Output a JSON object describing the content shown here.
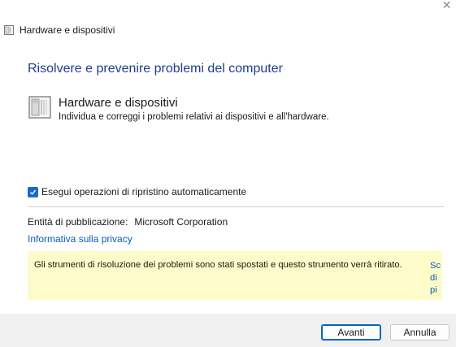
{
  "window": {
    "title": "Hardware e dispositivi",
    "close_glyph": "✕"
  },
  "heading": "Risolvere e prevenire problemi del computer",
  "item": {
    "title": "Hardware e dispositivi",
    "description": "Individua e correggi i problemi relativi ai dispositivi e all'hardware.",
    "icon": "device-icon"
  },
  "options": {
    "auto_repair_label": "Esegui operazioni di ripristino automaticamente",
    "auto_repair_checked": true
  },
  "publisher": {
    "label": "Entità di pubblicazione:",
    "value": "Microsoft Corporation"
  },
  "privacy_link": "Informativa sulla privacy",
  "notice": {
    "text": "Gli strumenti di risoluzione dei problemi sono stati spostati e questo strumento verrà ritirato.",
    "link_fragments": [
      "Sc",
      "di",
      "pi"
    ]
  },
  "buttons": {
    "next": "Avanti",
    "cancel": "Annulla"
  },
  "colors": {
    "accent": "#1b6ac9",
    "heading": "#1f3e8c",
    "link": "#0a5cb8",
    "notice_bg": "#fdfbc9",
    "footer_bg": "#f0f0f0"
  }
}
